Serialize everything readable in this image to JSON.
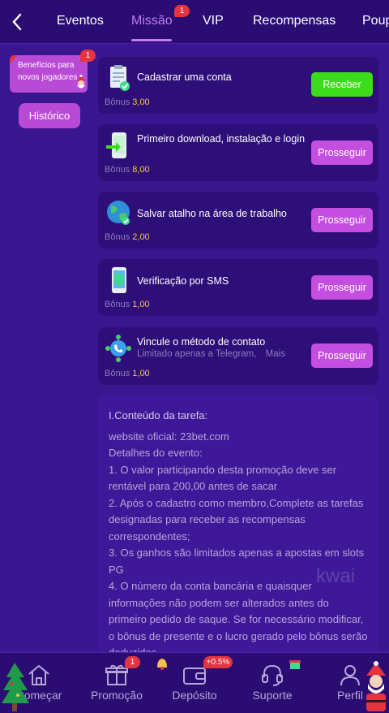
{
  "topnav": {
    "tabs": [
      {
        "label": "Eventos"
      },
      {
        "label": "Missão",
        "badge": "1"
      },
      {
        "label": "VIP"
      },
      {
        "label": "Recompensas"
      },
      {
        "label": "Poup"
      }
    ]
  },
  "sidebar": {
    "promo_label": "Benefícios para novos jogadores",
    "promo_badge": "1",
    "history_label": "Histórico"
  },
  "tasks": [
    {
      "title": "Cadastrar uma conta",
      "subtitle": "",
      "bonus_label": "Bônus",
      "bonus_value": "3,00",
      "button": "Receber",
      "button_state": "receive",
      "icon": "clipboard-check-icon"
    },
    {
      "title": "Primeiro download, instalação e login",
      "subtitle": "",
      "bonus_label": "Bônus",
      "bonus_value": "8,00",
      "button": "Prosseguir",
      "button_state": "go",
      "icon": "phone-download-icon"
    },
    {
      "title": "Salvar atalho na área de trabalho",
      "subtitle": "",
      "bonus_label": "Bônus",
      "bonus_value": "2,00",
      "button": "Prosseguir",
      "button_state": "go",
      "icon": "globe-icon"
    },
    {
      "title": "Verificação por SMS",
      "subtitle": "",
      "bonus_label": "Bônus",
      "bonus_value": "1,00",
      "button": "Prosseguir",
      "button_state": "go",
      "icon": "phone-shield-icon"
    },
    {
      "title": "Vincule o método de contato",
      "subtitle": "Limitado apenas a Telegram,",
      "subtitle_more": "Mais",
      "bonus_label": "Bônus",
      "bonus_value": "1,00",
      "button": "Prosseguir",
      "button_state": "go",
      "icon": "contact-network-icon"
    }
  ],
  "details": {
    "title": "I.Conteúdo da tarefa:",
    "website": "website oficial:  23bet.com",
    "subtitle": "Detalhes do evento:",
    "items": [
      "1. O valor participando desta promoção deve ser rentável para 200,00 antes de sacar",
      "2. Após o cadastro como membro,Complete as tarefas designadas para receber as recompensas correspondentes;",
      "3. Os ganhos são limitados apenas a apostas em slots PG",
      "4. O número da conta bancária e quaisquer informações não podem ser alterados antes do primeiro pedido de saque. Se for necessário modificar, o bônus de presente e o lucro gerado pelo bônus serão deduzidos"
    ]
  },
  "watermark": "kwai",
  "bottomnav": {
    "items": [
      {
        "label": "Começar",
        "icon": "home-icon"
      },
      {
        "label": "Promoção",
        "icon": "gift-icon",
        "badge": "1"
      },
      {
        "label": "Depósito",
        "icon": "wallet-icon",
        "badge": "+0.5%"
      },
      {
        "label": "Suporte",
        "icon": "headset-icon"
      },
      {
        "label": "Perfil",
        "icon": "user-icon"
      }
    ]
  },
  "colors": {
    "background": "#3a1590",
    "nav": "#2a0c72",
    "accent": "#c07cf0",
    "button_go": "#c44ee0",
    "button_receive": "#3ddc1a",
    "bonus_value": "#f2c14e",
    "badge": "#e5333f"
  }
}
